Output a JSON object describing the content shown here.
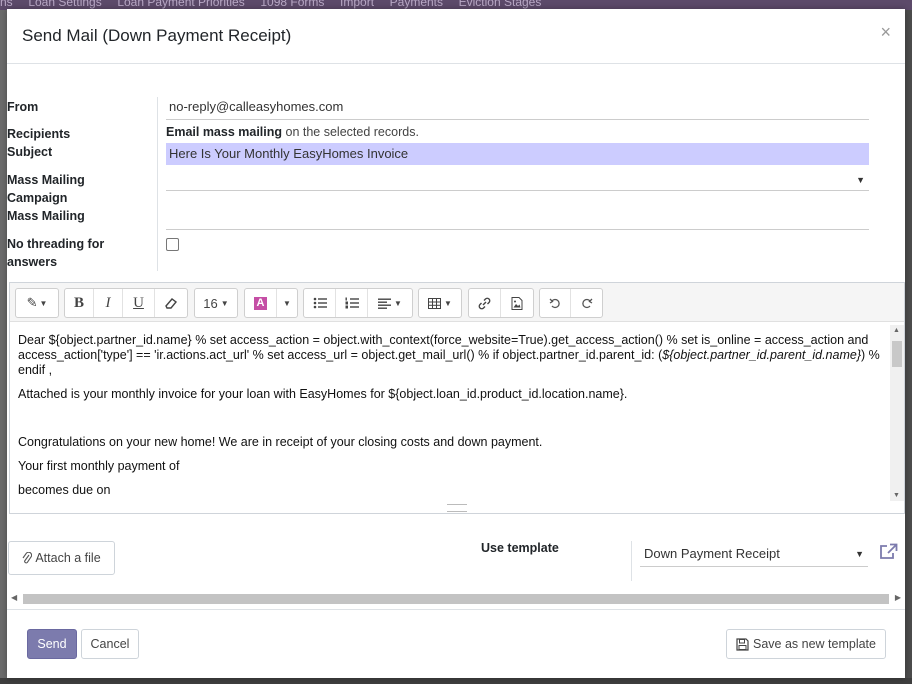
{
  "background": {
    "nav_items": [
      "ns",
      "Loan Settings",
      "Loan Payment Priorities",
      "1098 Forms",
      "Import",
      "Payments",
      "Eviction Stages"
    ]
  },
  "dialog": {
    "title": "Send Mail (Down Payment Receipt)",
    "close_glyph": "×"
  },
  "form": {
    "from_label": "From",
    "from_value": "no-reply@calleasyhomes.com",
    "recipients_label": "Recipients",
    "recipients_bold": "Email mass mailing",
    "recipients_rest": " on the selected records.",
    "subject_label": "Subject",
    "subject_value": "Here Is Your Monthly EasyHomes Invoice",
    "campaign_label_1": "Mass Mailing",
    "campaign_label_2": "Campaign",
    "campaign_value": "",
    "mass_mailing_label": "Mass Mailing",
    "mass_mailing_value": "",
    "no_threading_label_1": "No threading for",
    "no_threading_label_2": "answers"
  },
  "toolbar": {
    "font_size": "16"
  },
  "editor": {
    "line1": "Dear ${object.partner_id.name} % set access_action = object.with_context(force_website=True).get_access_action() % set is_online = access_action and access_action['type'] == 'ir.actions.act_url' % set access_url = object.get_mail_url() % if object.partner_id.parent_id: (",
    "line1_italic": "${object.partner_id.parent_id.name}",
    "line1_end": ") % endif ,",
    "line2": "Attached is your monthly invoice for your loan with EasyHomes for ${object.loan_id.product_id.location.name}.",
    "line3": "Congratulations on your new home! We are in receipt of your closing costs and down payment.",
    "line4": "Your first monthly payment of",
    "line5": "becomes due on"
  },
  "attachments": {
    "attach_label": "Attach a file"
  },
  "template": {
    "use_template_label": "Use template",
    "selected": "Down Payment Receipt"
  },
  "footer": {
    "send_label": "Send",
    "cancel_label": "Cancel",
    "save_template_label": "Save as new template"
  },
  "colors": {
    "primary": "#7c7bad",
    "subject_highlight": "#ccccff"
  }
}
